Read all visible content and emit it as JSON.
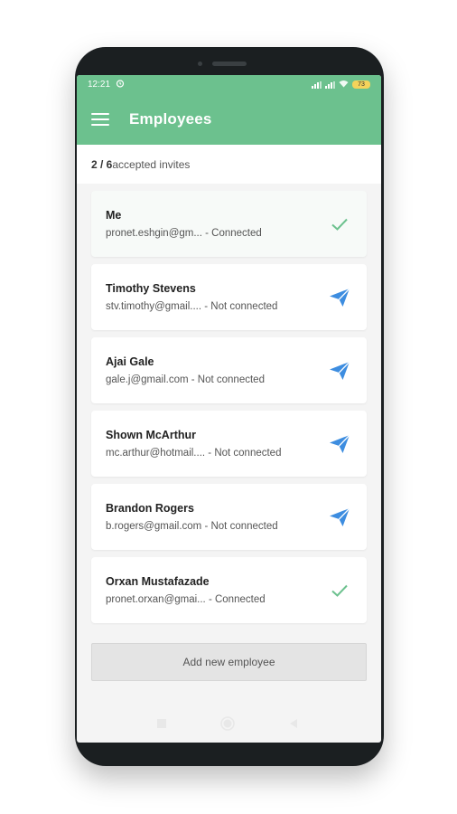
{
  "status": {
    "time": "12:21",
    "battery": "73"
  },
  "appbar": {
    "title": "Employees"
  },
  "summary": {
    "count": "2 / 6",
    "text": " accepted invites"
  },
  "employees": [
    {
      "name": "Me",
      "email": "pronet.eshgin@gm...",
      "status": " - Connected",
      "icon": "check-icon"
    },
    {
      "name": "Timothy Stevens",
      "email": "stv.timothy@gmail....",
      "status": " - Not connected",
      "icon": "send-icon"
    },
    {
      "name": "Ajai Gale",
      "email": "gale.j@gmail.com",
      "status": " - Not connected",
      "icon": "send-icon"
    },
    {
      "name": "Shown McArthur",
      "email": "mc.arthur@hotmail....",
      "status": " - Not connected",
      "icon": "send-icon"
    },
    {
      "name": "Brandon Rogers",
      "email": "b.rogers@gmail.com",
      "status": " - Not connected",
      "icon": "send-icon"
    },
    {
      "name": "Orxan Mustafazade",
      "email": "pronet.orxan@gmai...",
      "status": " - Connected",
      "icon": "check-icon"
    }
  ],
  "add_button": {
    "label": "Add new employee"
  },
  "colors": {
    "primary": "#6cc18e",
    "send": "#3d8de0",
    "check": "#6cc18e"
  }
}
